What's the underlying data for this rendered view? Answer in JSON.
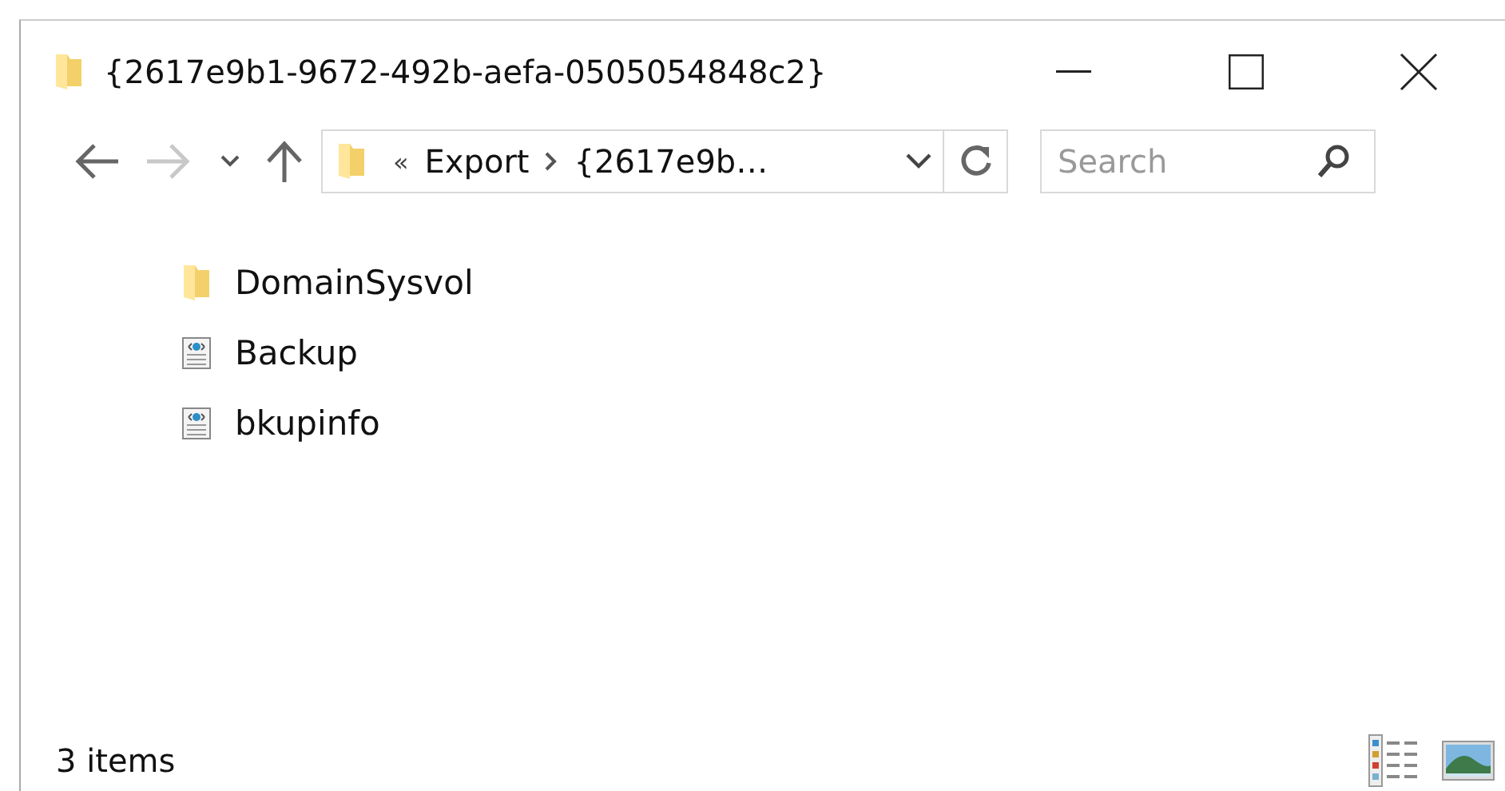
{
  "window": {
    "title": "{2617e9b1-9672-492b-aefa-0505054848c2}"
  },
  "nav": {
    "back_disabled": false,
    "forward_disabled": true
  },
  "address": {
    "overflow": "«",
    "crumbs": [
      "Export",
      "{2617e9b…"
    ]
  },
  "search": {
    "placeholder": "Search"
  },
  "items": [
    {
      "name": "DomainSysvol",
      "kind": "folder"
    },
    {
      "name": "Backup",
      "kind": "document"
    },
    {
      "name": "bkupinfo",
      "kind": "document"
    }
  ],
  "status_bar": {
    "count": "3 items"
  }
}
